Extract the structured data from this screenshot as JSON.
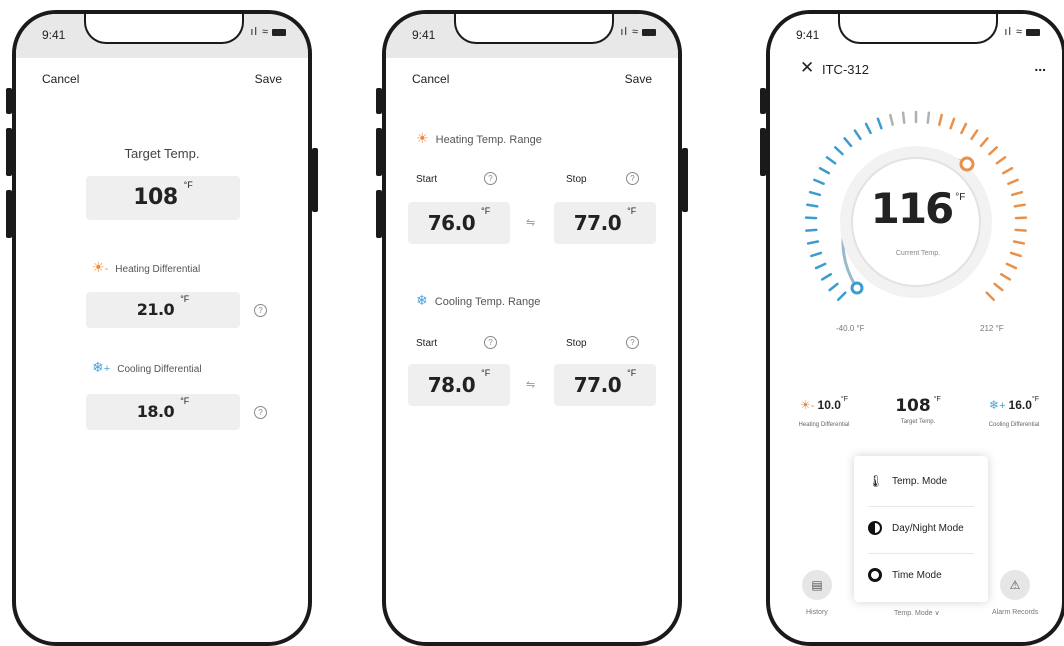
{
  "status": {
    "time": "9:41"
  },
  "screen1": {
    "cancel": "Cancel",
    "save": "Save",
    "target_label": "Target Temp.",
    "target_value": "108",
    "heating_label": "Heating Differential",
    "heating_value": "21.0",
    "cooling_label": "Cooling Differential",
    "cooling_value": "18.0",
    "unit": "°F"
  },
  "screen2": {
    "cancel": "Cancel",
    "save": "Save",
    "heating_range_label": "Heating Temp. Range",
    "cooling_range_label": "Cooling Temp. Range",
    "start_label": "Start",
    "stop_label": "Stop",
    "heat_start": "76.0",
    "heat_stop": "77.0",
    "cool_start": "78.0",
    "cool_stop": "77.0",
    "unit": "°F"
  },
  "screen3": {
    "device_name": "ITC-312",
    "more": "...",
    "current_value": "116",
    "current_unit": "°F",
    "current_label": "Current Temp.",
    "min_label": "-40.0 °F",
    "max_label": "212 °F",
    "heating_value": "10.0",
    "heating_label": "Heating Differential",
    "target_value": "108",
    "target_label": "Target Temp.",
    "cooling_value": "16.0",
    "cooling_label": "Cooling Differential",
    "unit": "°F",
    "menu": {
      "temp_mode": "Temp. Mode",
      "day_night_mode": "Day/Night Mode",
      "time_mode": "Time Mode"
    },
    "bottom": {
      "history": "History",
      "temp_mode": "Temp. Mode",
      "alarm_records": "Alarm Records"
    },
    "colors": {
      "heat": "#e8914a",
      "cool": "#3d9ccf"
    }
  }
}
